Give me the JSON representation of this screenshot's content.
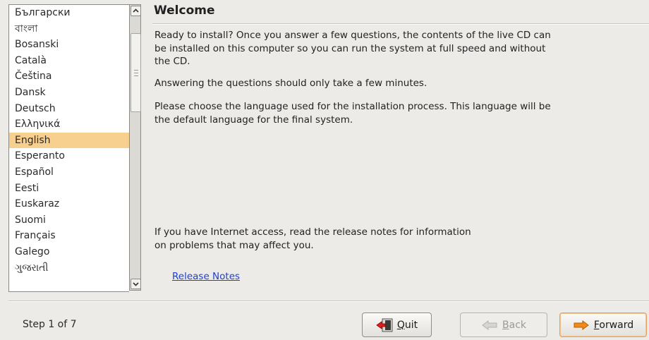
{
  "languages": {
    "items": [
      {
        "label": "Български"
      },
      {
        "label": "বাংলা"
      },
      {
        "label": "Bosanski"
      },
      {
        "label": "Català"
      },
      {
        "label": "Čeština"
      },
      {
        "label": "Dansk"
      },
      {
        "label": "Deutsch"
      },
      {
        "label": "Ελληνικά"
      },
      {
        "label": "English",
        "selected": true
      },
      {
        "label": "Esperanto"
      },
      {
        "label": "Español"
      },
      {
        "label": "Eesti"
      },
      {
        "label": "Euskaraz"
      },
      {
        "label": "Suomi"
      },
      {
        "label": "Français"
      },
      {
        "label": "Galego"
      },
      {
        "label": "ગુજરાતી"
      }
    ],
    "selected_color": "#f7cf8e"
  },
  "welcome": {
    "title": "Welcome",
    "p1": "Ready to install? Once you answer a few questions, the contents of the live CD can be installed on this computer so you can run the system at full speed and without the CD.",
    "p2": "Answering the questions should only take a few minutes.",
    "p3": "Please choose the language used for the installation process. This language will be the default language for the final system.",
    "p4": "If you have Internet access, read the release notes for information on problems that may affect you.",
    "release_notes_link": "Release Notes"
  },
  "footer": {
    "step": "Step 1 of 7",
    "quit": {
      "label": "Quit",
      "mnemonic": "Q",
      "rest": "uit",
      "icon": "quit-icon"
    },
    "back": {
      "label": "Back",
      "mnemonic": "B",
      "rest": "ack",
      "icon": "back-arrow-icon",
      "enabled": false
    },
    "forward": {
      "label": "Forward",
      "mnemonic": "F",
      "rest": "orward",
      "icon": "forward-arrow-icon"
    }
  }
}
